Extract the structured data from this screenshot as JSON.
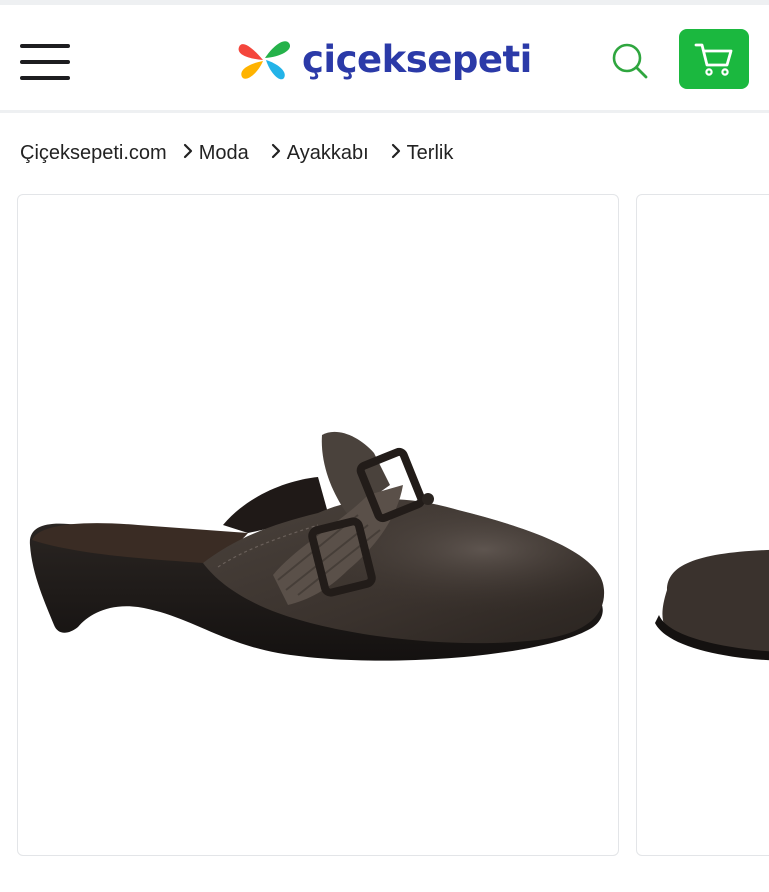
{
  "header": {
    "brand_name": "çiçeksepeti",
    "logo_colors": [
      "#f4463c",
      "#ffb300",
      "#23b3e8",
      "#25b24a"
    ],
    "accent_color": "#1bb83f",
    "menu_icon": "hamburger-menu-icon",
    "search_icon": "search-icon",
    "cart_icon": "shopping-cart-icon"
  },
  "breadcrumb": {
    "items": [
      {
        "label": "Çiçeksepeti.com"
      },
      {
        "label": "Moda"
      },
      {
        "label": "Ayakkabı"
      },
      {
        "label": "Terlik"
      }
    ]
  },
  "gallery": {
    "images": [
      {
        "subject": "dark brown leather mule slipper with buckle strap"
      },
      {
        "subject": "dark brown leather mule slipper (partial view)"
      }
    ]
  }
}
